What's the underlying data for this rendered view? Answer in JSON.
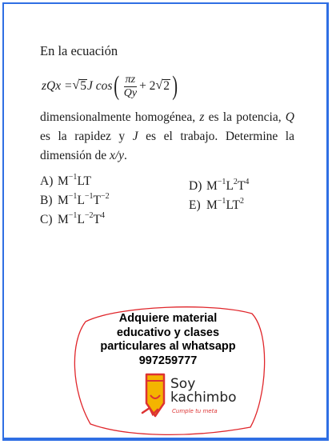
{
  "problem": {
    "intro": "En la ecuación",
    "equation": {
      "lhs": "zQx = ",
      "sqrt_radicand": "5",
      "after_sqrt": "J cos",
      "frac_num": "πz",
      "frac_den": "Qy",
      "plus_term": " + 2",
      "sqrt2_radicand": "2"
    },
    "statement": [
      {
        "t": "dimensionalmente homogénea, ",
        "i": false
      },
      {
        "t": "z",
        "i": true
      },
      {
        "t": " es la potencia, ",
        "i": false
      },
      {
        "t": "Q",
        "i": true
      },
      {
        "t": " es la rapidez y ",
        "i": false
      },
      {
        "t": "J",
        "i": true
      },
      {
        "t": " es el trabajo. Determine la dimensión de ",
        "i": false
      },
      {
        "t": "x/y",
        "i": true
      },
      {
        "t": ".",
        "i": false
      }
    ],
    "options": [
      {
        "letter": "A)",
        "parts": [
          [
            "M",
            ""
          ],
          [
            "",
            "−1"
          ],
          [
            "LT",
            ""
          ]
        ]
      },
      {
        "letter": "B)",
        "parts": [
          [
            "M",
            ""
          ],
          [
            "",
            "−1"
          ],
          [
            "L",
            ""
          ],
          [
            "",
            "−1"
          ],
          [
            "T",
            ""
          ],
          [
            "",
            "−2"
          ]
        ]
      },
      {
        "letter": "C)",
        "parts": [
          [
            "M",
            ""
          ],
          [
            "",
            "−1"
          ],
          [
            "L",
            ""
          ],
          [
            "",
            "−2"
          ],
          [
            "T",
            ""
          ],
          [
            "",
            "4"
          ]
        ]
      },
      {
        "letter": "D)",
        "parts": [
          [
            "M",
            ""
          ],
          [
            "",
            "−1"
          ],
          [
            "L",
            ""
          ],
          [
            "",
            "2"
          ],
          [
            "T",
            ""
          ],
          [
            "",
            "4"
          ]
        ]
      },
      {
        "letter": "E)",
        "parts": [
          [
            "M",
            ""
          ],
          [
            "",
            "−1"
          ],
          [
            "LT",
            ""
          ],
          [
            "",
            "2"
          ]
        ]
      }
    ]
  },
  "promo": {
    "lines": [
      "Adquiere material",
      "educativo y clases",
      "particulares al whatsapp",
      "997259777"
    ],
    "brand_line1": "Soy",
    "brand_line2": "kachimbo",
    "tagline": "Cumple tu meta",
    "icon": "pencil-icon",
    "colors": {
      "accent": "#e0262b",
      "pencil": "#f4b400",
      "frame": "#2f6fe4"
    }
  }
}
